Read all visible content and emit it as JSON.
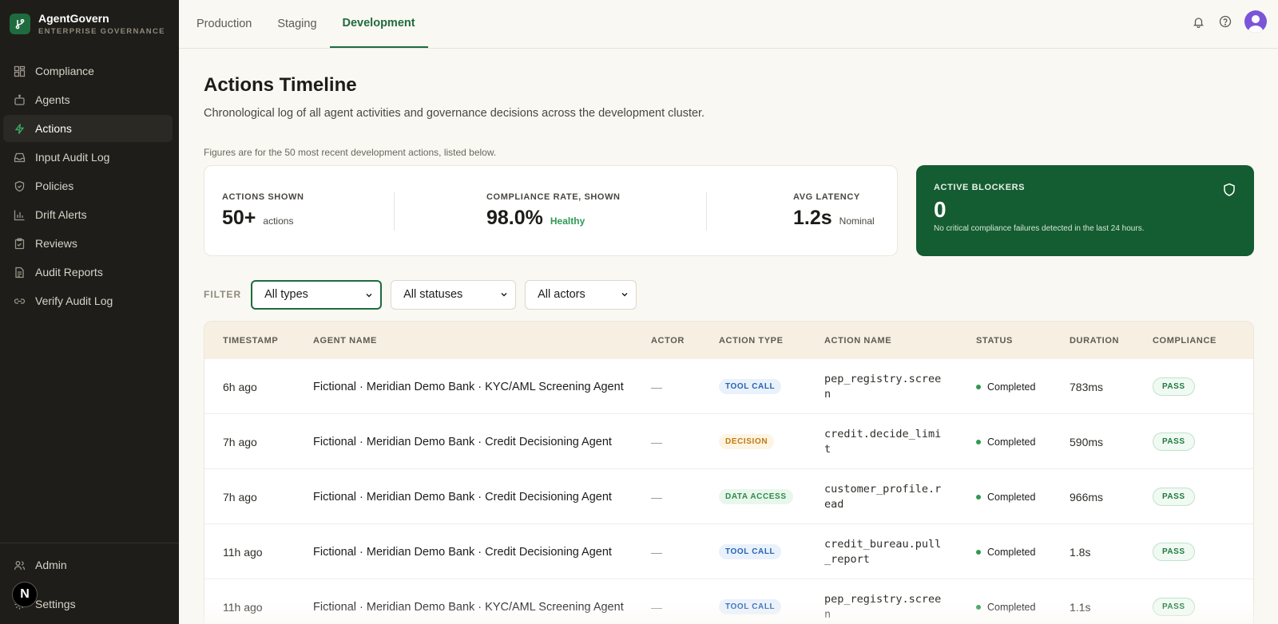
{
  "brand": {
    "name": "AgentGovern",
    "subtitle": "ENTERPRISE GOVERNANCE"
  },
  "sidebar": {
    "items": [
      {
        "label": "Compliance",
        "icon": "grid-icon"
      },
      {
        "label": "Agents",
        "icon": "bot-icon"
      },
      {
        "label": "Actions",
        "icon": "bolt-icon",
        "active": true
      },
      {
        "label": "Input Audit Log",
        "icon": "inbox-icon"
      },
      {
        "label": "Policies",
        "icon": "shield-icon"
      },
      {
        "label": "Drift Alerts",
        "icon": "bar-chart-icon"
      },
      {
        "label": "Reviews",
        "icon": "clipboard-icon"
      },
      {
        "label": "Audit Reports",
        "icon": "file-icon"
      },
      {
        "label": "Verify Audit Log",
        "icon": "link-icon"
      }
    ],
    "bottom": [
      {
        "label": "Admin",
        "icon": "users-icon"
      },
      {
        "label": "Settings",
        "icon": "gear-icon"
      }
    ],
    "badge": "N"
  },
  "tabs": [
    {
      "label": "Production"
    },
    {
      "label": "Staging"
    },
    {
      "label": "Development",
      "active": true
    }
  ],
  "page": {
    "title": "Actions Timeline",
    "description": "Chronological log of all agent activities and governance decisions across the development cluster.",
    "figures_note": "Figures are for the 50 most recent development actions, listed below."
  },
  "stats": {
    "actions": {
      "label": "ACTIONS SHOWN",
      "value": "50+",
      "sub": "actions"
    },
    "compliance": {
      "label": "COMPLIANCE RATE, SHOWN",
      "value": "98.0%",
      "sub": "Healthy"
    },
    "latency": {
      "label": "AVG LATENCY",
      "value": "1.2s",
      "sub": "Nominal"
    },
    "blockers": {
      "label": "ACTIVE BLOCKERS",
      "value": "0",
      "desc": "No critical compliance failures detected in the last 24 hours."
    }
  },
  "filters": {
    "label": "FILTER",
    "type": "All types",
    "status": "All statuses",
    "actor": "All actors"
  },
  "table": {
    "columns": [
      "TIMESTAMP",
      "AGENT NAME",
      "ACTOR",
      "ACTION TYPE",
      "ACTION NAME",
      "STATUS",
      "DURATION",
      "COMPLIANCE"
    ],
    "rows": [
      {
        "timestamp": "6h ago",
        "agent": "Fictional · Meridian Demo Bank · KYC/AML Screening Agent",
        "actor": "—",
        "type": "TOOL CALL",
        "type_kind": "tool",
        "action": "pep_registry.screen",
        "status": "Completed",
        "duration": "783ms",
        "compliance": "PASS"
      },
      {
        "timestamp": "7h ago",
        "agent": "Fictional · Meridian Demo Bank · Credit Decisioning Agent",
        "actor": "—",
        "type": "DECISION",
        "type_kind": "decision",
        "action": "credit.decide_limit",
        "status": "Completed",
        "duration": "590ms",
        "compliance": "PASS"
      },
      {
        "timestamp": "7h ago",
        "agent": "Fictional · Meridian Demo Bank · Credit Decisioning Agent",
        "actor": "—",
        "type": "DATA ACCESS",
        "type_kind": "data",
        "action": "customer_profile.read",
        "status": "Completed",
        "duration": "966ms",
        "compliance": "PASS"
      },
      {
        "timestamp": "11h ago",
        "agent": "Fictional · Meridian Demo Bank · Credit Decisioning Agent",
        "actor": "—",
        "type": "TOOL CALL",
        "type_kind": "tool",
        "action": "credit_bureau.pull_report",
        "status": "Completed",
        "duration": "1.8s",
        "compliance": "PASS"
      },
      {
        "timestamp": "11h ago",
        "agent": "Fictional · Meridian Demo Bank · KYC/AML Screening Agent",
        "actor": "—",
        "type": "TOOL CALL",
        "type_kind": "tool",
        "action": "pep_registry.screen",
        "status": "Completed",
        "duration": "1.1s",
        "compliance": "PASS"
      }
    ]
  },
  "colors": {
    "accent": "#1f6b3f",
    "sidebar": "#1f1d19",
    "blocker_card": "#145c31",
    "status_green": "#2e9a52"
  }
}
